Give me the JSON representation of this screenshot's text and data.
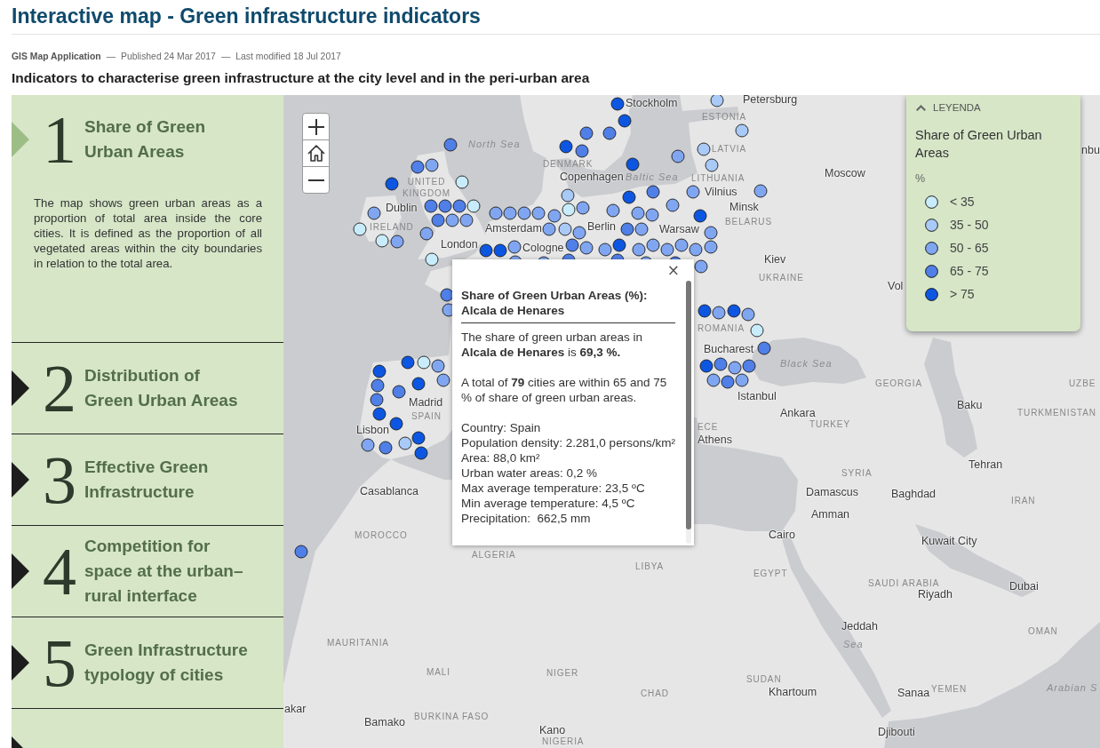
{
  "header": {
    "title": "Interactive map - Green infrastructure indicators",
    "byline": [
      {
        "kind": "source",
        "text": "GIS Map Application"
      },
      {
        "kind": "separator",
        "text": "—"
      },
      {
        "kind": "date",
        "text": "Published 24 Mar 2017"
      },
      {
        "kind": "separator",
        "text": "—"
      },
      {
        "kind": "date",
        "text": "Last modified 18 Jul 2017"
      }
    ],
    "subtitle": "Indicators to characterise green infrastructure at the city level and in the peri-urban area"
  },
  "indicators": [
    {
      "number": "1",
      "title": "Share of Green Urban Areas",
      "selected": true,
      "description": "The map shows green urban areas as a proportion of total area inside the core cities. It is defined as the proportion of all vegetated areas within the city boundaries in relation to the total area."
    },
    {
      "number": "2",
      "title": "Distribution of Green Urban Areas",
      "selected": false
    },
    {
      "number": "3",
      "title": "Effective Green Infrastructure",
      "selected": false
    },
    {
      "number": "4",
      "title": "Competition for space at the urban–rural interface",
      "selected": false
    },
    {
      "number": "5",
      "title": "Green Infrastructure typology of cities",
      "selected": false
    },
    {
      "selected": false
    }
  ],
  "map": {
    "labels": [
      {
        "text": "Stockholm",
        "kind": "city"
      },
      {
        "text": "Petersburg",
        "kind": "city"
      },
      {
        "text": "ESTONIA",
        "kind": "country"
      },
      {
        "text": "North Sea",
        "kind": "sea"
      },
      {
        "text": "LATVIA",
        "kind": "country"
      },
      {
        "text": "nbu",
        "kind": "city"
      },
      {
        "text": "DENMARK",
        "kind": "country"
      },
      {
        "text": "UNITED KINGDOM",
        "kind": "country"
      },
      {
        "text": "Copenhagen",
        "kind": "city"
      },
      {
        "text": "Baltic Sea",
        "kind": "sea"
      },
      {
        "text": "LITHUANIA",
        "kind": "country"
      },
      {
        "text": "Moscow",
        "kind": "city"
      },
      {
        "text": "Vilnius",
        "kind": "city"
      },
      {
        "text": "Dublin",
        "kind": "city"
      },
      {
        "text": "Minsk",
        "kind": "city"
      },
      {
        "text": "IRELAND",
        "kind": "country"
      },
      {
        "text": "Amsterdam",
        "kind": "city"
      },
      {
        "text": "Berlin",
        "kind": "city"
      },
      {
        "text": "Warsaw",
        "kind": "city"
      },
      {
        "text": "BELARUS",
        "kind": "country"
      },
      {
        "text": "London",
        "kind": "city"
      },
      {
        "text": "Cologne",
        "kind": "city"
      },
      {
        "text": "Kiev",
        "kind": "city"
      },
      {
        "text": "UKRAINE",
        "kind": "country"
      },
      {
        "text": "Vol",
        "kind": "city"
      },
      {
        "text": "ROMANIA",
        "kind": "country"
      },
      {
        "text": "Bucharest",
        "kind": "city"
      },
      {
        "text": "Black Sea",
        "kind": "sea"
      },
      {
        "text": "GEORGIA",
        "kind": "country"
      },
      {
        "text": "UZBE",
        "kind": "country"
      },
      {
        "text": "Madrid",
        "kind": "city"
      },
      {
        "text": "Istanbul",
        "kind": "city"
      },
      {
        "text": "SPAIN",
        "kind": "country"
      },
      {
        "text": "Ankara",
        "kind": "city"
      },
      {
        "text": "Baku",
        "kind": "city"
      },
      {
        "text": "TURKMENISTAN",
        "kind": "country"
      },
      {
        "text": "Lisbon",
        "kind": "city"
      },
      {
        "text": "ECE",
        "kind": "country"
      },
      {
        "text": "TURKEY",
        "kind": "country"
      },
      {
        "text": "Athens",
        "kind": "city"
      },
      {
        "text": "SYRIA",
        "kind": "country"
      },
      {
        "text": "Tehran",
        "kind": "city"
      },
      {
        "text": "Casablanca",
        "kind": "city"
      },
      {
        "text": "Damascus",
        "kind": "city"
      },
      {
        "text": "Baghdad",
        "kind": "city"
      },
      {
        "text": "IRAN",
        "kind": "country"
      },
      {
        "text": "Amman",
        "kind": "city"
      },
      {
        "text": "MOROCCO",
        "kind": "country"
      },
      {
        "text": "Cairo",
        "kind": "city"
      },
      {
        "text": "Kuwait City",
        "kind": "city"
      },
      {
        "text": "ALGERIA",
        "kind": "country"
      },
      {
        "text": "LIBYA",
        "kind": "country"
      },
      {
        "text": "EGYPT",
        "kind": "country"
      },
      {
        "text": "SAUDI ARABIA",
        "kind": "country"
      },
      {
        "text": "Riyadh",
        "kind": "city"
      },
      {
        "text": "Dubai",
        "kind": "city"
      },
      {
        "text": "Jeddah",
        "kind": "city"
      },
      {
        "text": "OMAN",
        "kind": "country"
      },
      {
        "text": "MAURITANIA",
        "kind": "country"
      },
      {
        "text": "Sea",
        "kind": "sea"
      },
      {
        "text": "MALI",
        "kind": "country"
      },
      {
        "text": "NIGER",
        "kind": "country"
      },
      {
        "text": "SUDAN",
        "kind": "country"
      },
      {
        "text": "CHAD",
        "kind": "country"
      },
      {
        "text": "Khartoum",
        "kind": "city"
      },
      {
        "text": "Sanaa",
        "kind": "city"
      },
      {
        "text": "YEMEN",
        "kind": "country"
      },
      {
        "text": "Arabian S",
        "kind": "sea"
      },
      {
        "text": "akar",
        "kind": "city"
      },
      {
        "text": "Bamako",
        "kind": "city"
      },
      {
        "text": "BURKINA FASO",
        "kind": "country"
      },
      {
        "text": "Kano",
        "kind": "city"
      },
      {
        "text": "NIGERIA",
        "kind": "country"
      },
      {
        "text": "Djibouti",
        "kind": "city"
      }
    ]
  },
  "popup": {
    "close": "×",
    "title": "Share of Green Urban Areas (%):",
    "place": "Alcala de Henares",
    "summary": "The share of green urban areas in **Alcala de Henares** is **69,3 %.**",
    "count_note": "A total of **79** cities are within 65 and 75 % of share of green urban areas.",
    "details": [
      "Country: Spain",
      "Population density: 2.281,0 persons/km²",
      "Area: 88,0 km²",
      "Urban water areas: 0,2 %",
      "Max average temperature: 23,5 ºC",
      "Min average temperature: 4,5 ºC",
      "Precipitation:  662,5 mm"
    ]
  },
  "legend": {
    "toggle": "LEYENDA",
    "expanded": true,
    "title": "Share of Green Urban Areas",
    "unit": "%",
    "items": [
      {
        "label": "< 35",
        "color": "#c8ecfb"
      },
      {
        "label": "35 - 50",
        "color": "#a9c9f6"
      },
      {
        "label": "50 - 65",
        "color": "#80a6f1"
      },
      {
        "label": "65 - 75",
        "color": "#4f7fe7"
      },
      {
        "label": "> 75",
        "color": "#0c56e2"
      }
    ]
  }
}
